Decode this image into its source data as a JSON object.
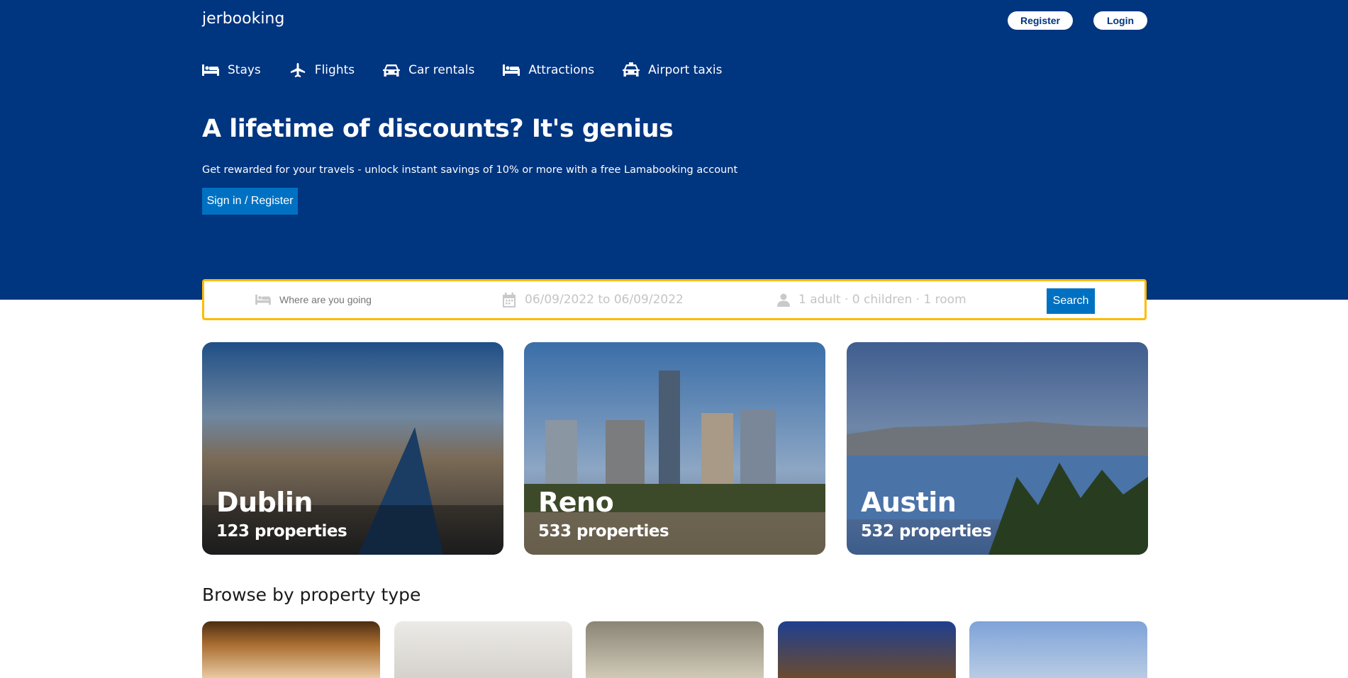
{
  "header": {
    "logo": "jerbooking",
    "register_label": "Register",
    "login_label": "Login"
  },
  "nav": {
    "items": [
      {
        "label": "Stays",
        "icon": "bed-icon"
      },
      {
        "label": "Flights",
        "icon": "plane-icon"
      },
      {
        "label": "Car rentals",
        "icon": "car-icon"
      },
      {
        "label": "Attractions",
        "icon": "bed-icon"
      },
      {
        "label": "Airport taxis",
        "icon": "taxi-icon"
      }
    ]
  },
  "hero": {
    "title": "A lifetime of discounts? It's genius",
    "subtitle": "Get rewarded for your travels - unlock instant savings of 10% or more with a free Lamabooking account",
    "cta_label": "Sign in / Register"
  },
  "search": {
    "destination_placeholder": "Where are you going",
    "dates": "06/09/2022 to 06/09/2022",
    "guests": "1 adult · 0 children · 1 room",
    "button_label": "Search"
  },
  "featured": [
    {
      "name": "Dublin",
      "count": "123 properties"
    },
    {
      "name": "Reno",
      "count": "533 properties"
    },
    {
      "name": "Austin",
      "count": "532 properties"
    }
  ],
  "property_types": {
    "title": "Browse by property type"
  },
  "colors": {
    "brand": "#003580",
    "accent": "#0071c2",
    "search_border": "#febb02"
  }
}
